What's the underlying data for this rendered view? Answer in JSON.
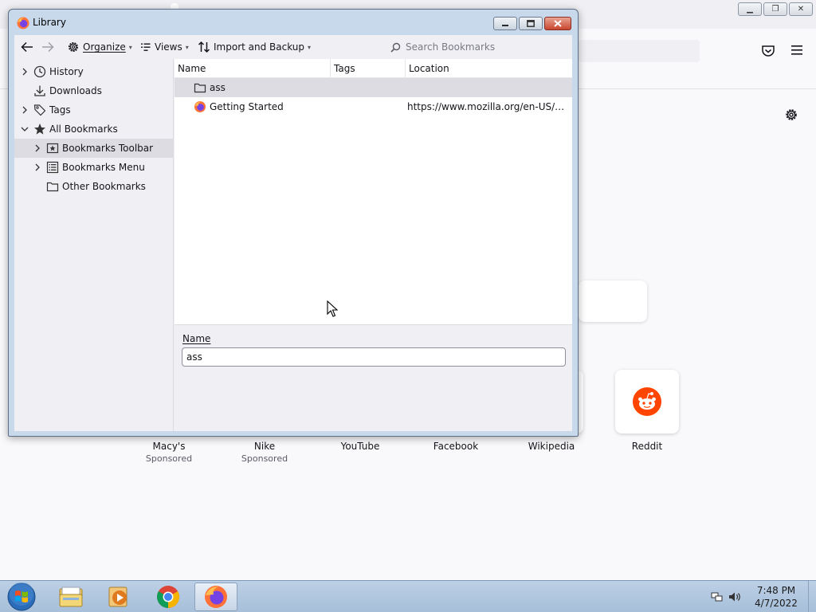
{
  "library": {
    "title": "Library",
    "controls": {
      "minimize": "minimize",
      "maximize": "maximize",
      "close": "close"
    },
    "toolbar": {
      "back_icon": "back-arrow-icon",
      "forward_icon": "forward-arrow-icon",
      "organize_label": "Organize",
      "views_label": "Views",
      "import_label": "Import and Backup",
      "search_placeholder": "Search Bookmarks"
    },
    "tree": [
      {
        "label": "History",
        "icon": "clock-icon",
        "twisty": "›",
        "selected": false
      },
      {
        "label": "Downloads",
        "icon": "download-icon",
        "twisty": "",
        "selected": false
      },
      {
        "label": "Tags",
        "icon": "tag-icon",
        "twisty": "›",
        "selected": false
      },
      {
        "label": "All Bookmarks",
        "icon": "star-icon",
        "twisty": "⌄",
        "selected": false
      },
      {
        "label": "Bookmarks Toolbar",
        "icon": "bookmarks-toolbar-icon",
        "twisty": "›",
        "selected": true
      },
      {
        "label": "Bookmarks Menu",
        "icon": "bookmarks-menu-icon",
        "twisty": "›",
        "selected": false
      },
      {
        "label": "Other Bookmarks",
        "icon": "folder-icon",
        "twisty": "",
        "selected": false
      }
    ],
    "columns": {
      "name": "Name",
      "tags": "Tags",
      "location": "Location"
    },
    "rows": [
      {
        "name": "ass",
        "tags": "",
        "location": "",
        "icon": "folder-icon",
        "selected": true
      },
      {
        "name": "Getting Started",
        "tags": "",
        "location": "https://www.mozilla.org/en-US/firef...",
        "icon": "firefox-icon",
        "selected": false
      }
    ],
    "details": {
      "name_label": "Name",
      "name_value": "ass"
    }
  },
  "newtab": {
    "tiles": [
      {
        "title": "Macy's",
        "sub": "Sponsored"
      },
      {
        "title": "Nike",
        "sub": "Sponsored"
      },
      {
        "title": "YouTube",
        "sub": ""
      },
      {
        "title": "Facebook",
        "sub": ""
      },
      {
        "title": "Wikipedia",
        "sub": ""
      },
      {
        "title": "Reddit",
        "sub": ""
      }
    ]
  },
  "taskbar": {
    "apps": [
      "start-orb",
      "file-explorer",
      "media-player",
      "chrome",
      "firefox"
    ],
    "clock_time": "7:48 PM",
    "clock_date": "4/7/2022"
  },
  "colors": {
    "accent_selected": "#dcdce2",
    "reddit": "#ff4500",
    "chrome_red": "#db4437",
    "firefox_orange": "#ff7139"
  }
}
